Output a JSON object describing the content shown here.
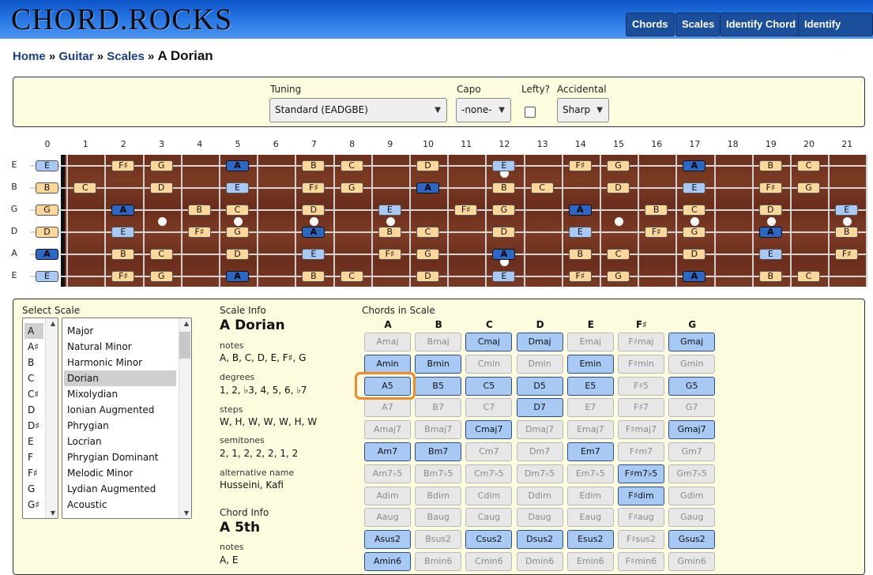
{
  "header": {
    "logo": "CHORD.ROCKS",
    "nav": [
      "Chords",
      "Scales",
      "Identify Chord",
      "Identify Scale"
    ]
  },
  "breadcrumb": {
    "home": "Home",
    "guitar": "Guitar",
    "scales": "Scales",
    "sep": "»",
    "current": "A Dorian"
  },
  "settings": {
    "tuning_label": "Tuning",
    "tuning_value": "Standard (EADGBE)",
    "capo_label": "Capo",
    "capo_value": "-none-",
    "lefty_label": "Lefty?",
    "lefty_checked": false,
    "accidental_label": "Accidental",
    "accidental_value": "Sharp"
  },
  "fretboard": {
    "fret_numbers": [
      "0",
      "1",
      "2",
      "3",
      "4",
      "5",
      "6",
      "7",
      "8",
      "9",
      "10",
      "11",
      "12",
      "13",
      "14",
      "15",
      "16",
      "17",
      "18",
      "19",
      "20",
      "21"
    ],
    "strings": [
      "E",
      "B",
      "G",
      "D",
      "A",
      "E"
    ],
    "notes": [
      [
        "E",
        "",
        "F♯",
        "G",
        "",
        "A",
        "",
        "B",
        "C",
        "",
        "D",
        "",
        "E",
        "",
        "F♯",
        "G",
        "",
        "A",
        "",
        "B",
        "C",
        ""
      ],
      [
        "B",
        "C",
        "",
        "D",
        "",
        "E",
        "",
        "F♯",
        "G",
        "",
        "A",
        "",
        "B",
        "C",
        "",
        "D",
        "",
        "E",
        "",
        "F♯",
        "G",
        ""
      ],
      [
        "G",
        "",
        "A",
        "",
        "B",
        "C",
        "",
        "D",
        "",
        "E",
        "",
        "F♯",
        "G",
        "",
        "A",
        "",
        "B",
        "C",
        "",
        "D",
        "",
        "E"
      ],
      [
        "D",
        "",
        "E",
        "",
        "F♯",
        "G",
        "",
        "A",
        "",
        "B",
        "C",
        "",
        "D",
        "",
        "E",
        "",
        "F♯",
        "G",
        "",
        "A",
        "",
        "B"
      ],
      [
        "A",
        "",
        "B",
        "C",
        "",
        "D",
        "",
        "E",
        "",
        "F♯",
        "G",
        "",
        "A",
        "",
        "B",
        "C",
        "",
        "D",
        "",
        "E",
        "",
        "F♯"
      ],
      [
        "E",
        "",
        "F♯",
        "G",
        "",
        "A",
        "",
        "B",
        "C",
        "",
        "D",
        "",
        "E",
        "",
        "F♯",
        "G",
        "",
        "A",
        "",
        "B",
        "C",
        ""
      ]
    ],
    "single_dots": [
      "3",
      "5",
      "7",
      "9",
      "15",
      "17",
      "19",
      "21"
    ],
    "double_dots": [
      "12"
    ]
  },
  "select_scale": {
    "title": "Select Scale",
    "roots": [
      "A",
      "A♯",
      "B",
      "C",
      "C♯",
      "D",
      "D♯",
      "E",
      "F",
      "F♯",
      "G",
      "G♯"
    ],
    "selected_root": "A",
    "scales": [
      "Major",
      "Natural Minor",
      "Harmonic Minor",
      "Dorian",
      "Mixolydian",
      "Ionian Augmented",
      "Phrygian",
      "Locrian",
      "Phrygian Dominant",
      "Melodic Minor",
      "Lydian Augmented",
      "Acoustic"
    ],
    "selected_scale": "Dorian"
  },
  "scale_info": {
    "title": "Scale Info",
    "name": "A Dorian",
    "notes_label": "notes",
    "notes": "A, B, C, D, E, F♯, G",
    "degrees_label": "degrees",
    "degrees": "1, 2, ♭3, 4, 5, 6, ♭7",
    "steps_label": "steps",
    "steps": "W, H, W, W, W, H, W",
    "semitones_label": "semitones",
    "semitones": "2, 1, 2, 2, 2, 1, 2",
    "alt_label": "alternative name",
    "alt": "Husseini, Kafi"
  },
  "chord_info": {
    "title": "Chord Info",
    "name": "A 5th",
    "notes_label": "notes",
    "notes": "A, E"
  },
  "chords_in_scale": {
    "title": "Chords in Scale",
    "columns": [
      "A",
      "B",
      "C",
      "D",
      "E",
      "F♯",
      "G"
    ],
    "selected": "A5",
    "rows": [
      [
        [
          "Amaj",
          false
        ],
        [
          "Bmaj",
          false
        ],
        [
          "Cmaj",
          true
        ],
        [
          "Dmaj",
          true
        ],
        [
          "Emaj",
          false
        ],
        [
          "F♯maj",
          false
        ],
        [
          "Gmaj",
          true
        ]
      ],
      [
        [
          "Amin",
          true
        ],
        [
          "Bmin",
          true
        ],
        [
          "Cmin",
          false
        ],
        [
          "Dmin",
          false
        ],
        [
          "Emin",
          true
        ],
        [
          "F♯min",
          false
        ],
        [
          "Gmin",
          false
        ]
      ],
      [
        [
          "A5",
          true
        ],
        [
          "B5",
          true
        ],
        [
          "C5",
          true
        ],
        [
          "D5",
          true
        ],
        [
          "E5",
          true
        ],
        [
          "F♯5",
          false
        ],
        [
          "G5",
          true
        ]
      ],
      [
        [
          "A7",
          false
        ],
        [
          "B7",
          false
        ],
        [
          "C7",
          false
        ],
        [
          "D7",
          true
        ],
        [
          "E7",
          false
        ],
        [
          "F♯7",
          false
        ],
        [
          "G7",
          false
        ]
      ],
      [
        [
          "Amaj7",
          false
        ],
        [
          "Bmaj7",
          false
        ],
        [
          "Cmaj7",
          true
        ],
        [
          "Dmaj7",
          false
        ],
        [
          "Emaj7",
          false
        ],
        [
          "F♯maj7",
          false
        ],
        [
          "Gmaj7",
          true
        ]
      ],
      [
        [
          "Am7",
          true
        ],
        [
          "Bm7",
          true
        ],
        [
          "Cm7",
          false
        ],
        [
          "Dm7",
          false
        ],
        [
          "Em7",
          true
        ],
        [
          "F♯m7",
          false
        ],
        [
          "Gm7",
          false
        ]
      ],
      [
        [
          "Am7♭5",
          false
        ],
        [
          "Bm7♭5",
          false
        ],
        [
          "Cm7♭5",
          false
        ],
        [
          "Dm7♭5",
          false
        ],
        [
          "Em7♭5",
          false
        ],
        [
          "F♯m7♭5",
          true
        ],
        [
          "Gm7♭5",
          false
        ]
      ],
      [
        [
          "Adim",
          false
        ],
        [
          "Bdim",
          false
        ],
        [
          "Cdim",
          false
        ],
        [
          "Ddim",
          false
        ],
        [
          "Edim",
          false
        ],
        [
          "F♯dim",
          true
        ],
        [
          "Gdim",
          false
        ]
      ],
      [
        [
          "Aaug",
          false
        ],
        [
          "Baug",
          false
        ],
        [
          "Caug",
          false
        ],
        [
          "Daug",
          false
        ],
        [
          "Eaug",
          false
        ],
        [
          "F♯aug",
          false
        ],
        [
          "Gaug",
          false
        ]
      ],
      [
        [
          "Asus2",
          true
        ],
        [
          "Bsus2",
          false
        ],
        [
          "Csus2",
          true
        ],
        [
          "Dsus2",
          true
        ],
        [
          "Esus2",
          true
        ],
        [
          "F♯sus2",
          false
        ],
        [
          "Gsus2",
          true
        ]
      ],
      [
        [
          "Amin6",
          true
        ],
        [
          "Bmin6",
          false
        ],
        [
          "Cmin6",
          false
        ],
        [
          "Dmin6",
          false
        ],
        [
          "Emin6",
          false
        ],
        [
          "F♯min6",
          false
        ],
        [
          "Gmin6",
          false
        ]
      ]
    ]
  },
  "colors": {
    "header_blue": "#2a7ae6",
    "panel_bg": "#fdfcdf",
    "fret_wood": "#6b2f1c",
    "note_tan": "#fbd89a",
    "note_blue": "#a9c9f5",
    "root_blue": "#2d67c4",
    "highlight_orange": "#f08a2a"
  }
}
